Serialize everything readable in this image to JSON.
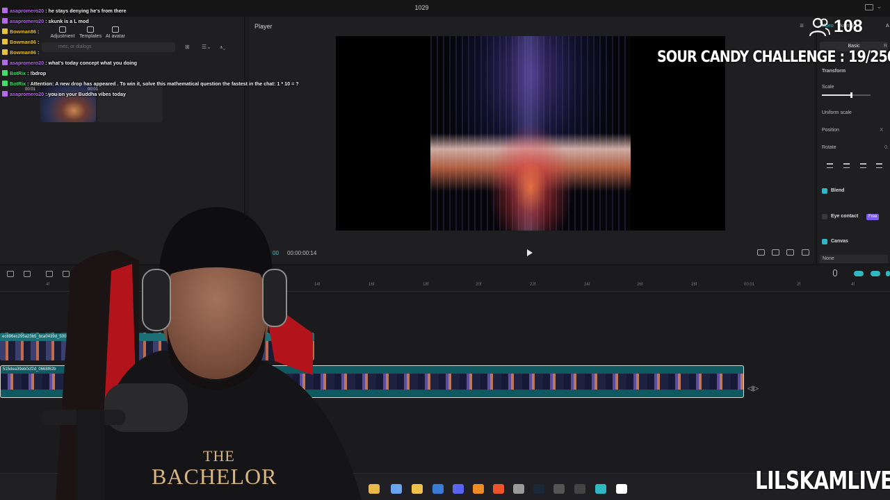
{
  "editor": {
    "window_title": "1029",
    "toolbar_tabs": [
      {
        "label": "Adjustment",
        "icon": "adjustment-icon"
      },
      {
        "label": "Templates",
        "icon": "templates-icon"
      },
      {
        "label": "AI avatar",
        "icon": "ai-avatar-icon"
      }
    ],
    "search_placeholder": "mes, or dialogs",
    "media_clips": [
      {
        "duration": "00:01",
        "added": "Added"
      },
      {
        "duration": "00:01"
      }
    ],
    "player": {
      "title": "Player",
      "time_current": "00",
      "time_total": "00:00:00:14"
    },
    "properties": {
      "tab_main": "Video",
      "tab_animation": "Animation",
      "tab_extra": "A",
      "subtab_basic": "Basic",
      "subtab_other": "R",
      "section_transform": "Transform",
      "scale_label": "Scale",
      "scale_level": 0.6,
      "uniform_scale_label": "Uniform scale",
      "position_label": "Position",
      "position_value": "X",
      "rotate_label": "Rotate",
      "rotate_value": "0.",
      "blend_label": "Blend",
      "eye_contact_label": "Eye contact",
      "free_badge": "Free",
      "canvas_label": "Canvas",
      "canvas_value": "None"
    },
    "timeline": {
      "ruler_ticks": [
        "4f",
        "4f",
        "14f",
        "16f",
        "18f",
        "20f",
        "22f",
        "24f",
        "26f",
        "28f",
        "00:01",
        "2f",
        "4f"
      ],
      "clip_top_name": "ec896ec295a23b5_bca0439d_500.gif",
      "clip_main_name": "515dea39eb0cf2d_0668f62b"
    }
  },
  "chat": {
    "messages": [
      {
        "user": "asapromero20",
        "user_color": "#b36ae6",
        "text": "he stays denying he's from there"
      },
      {
        "user": "asapromero20",
        "user_color": "#b36ae6",
        "text": "skunk is a L mod"
      },
      {
        "user": "Bowman86",
        "user_color": "#e8c23a",
        "text": ""
      },
      {
        "user": "Bowman86",
        "user_color": "#e8c23a",
        "text": ""
      },
      {
        "user": "Bowman86",
        "user_color": "#e8c23a",
        "text": ""
      },
      {
        "user": "asapromero20",
        "user_color": "#b36ae6",
        "text": "what's today concept what you doing"
      },
      {
        "user": "BotRix",
        "user_color": "#3ee06b",
        "text": "!bdrop"
      },
      {
        "user": "BotRix",
        "user_color": "#3ee06b",
        "text": "Attention: A new drop has appeared . To win it, solve this mathematical question the fastest in the chat: 1 * 10 = ?"
      },
      {
        "user": "asapromero20",
        "user_color": "#b36ae6",
        "text": "you on your Buddha vibes today"
      }
    ]
  },
  "overlay": {
    "viewer_count": "108",
    "viewer_icon": "viewers-icon",
    "challenge_text": "SOUR CANDY CHALLENGE : 19/250",
    "brand": "LILSKAMLIVE",
    "shirt_line1": "THE",
    "shirt_line2": "BACHELOR"
  },
  "colors": {
    "accent": "#2fb7c2",
    "free_badge": "#7c5cf0"
  }
}
